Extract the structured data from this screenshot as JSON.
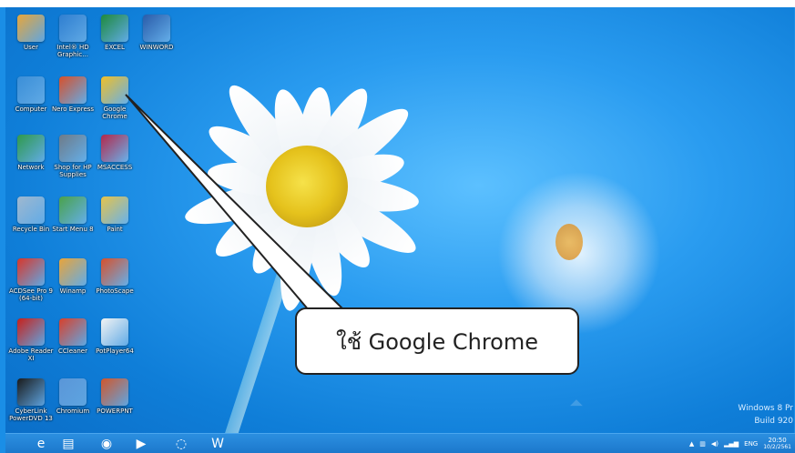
{
  "desktop": {
    "icons": [
      {
        "label": "User",
        "icon": "user-folder-icon",
        "color": "#e8a63a"
      },
      {
        "label": "Intel® HD Graphic...",
        "icon": "intel-graphics-icon",
        "color": "#2f7fd1"
      },
      {
        "label": "EXCEL",
        "icon": "excel-icon",
        "color": "#1f8a3c"
      },
      {
        "label": "WINWORD",
        "icon": "word-icon",
        "color": "#2a5caa"
      },
      {
        "label": "Computer",
        "icon": "computer-icon",
        "color": "#3b8fd8"
      },
      {
        "label": "Nero Express",
        "icon": "nero-icon",
        "color": "#d8502a"
      },
      {
        "label": "Google Chrome",
        "icon": "chrome-icon",
        "color": "#f2c027"
      },
      {
        "label": "Network",
        "icon": "network-icon",
        "color": "#2f9a4b"
      },
      {
        "label": "Shop for HP Supplies",
        "icon": "hp-shop-icon",
        "color": "#6f7b88"
      },
      {
        "label": "MSACCESS",
        "icon": "access-icon",
        "color": "#b4284a"
      },
      {
        "label": "Recycle Bin",
        "icon": "recycle-bin-icon",
        "color": "#9fb8cf"
      },
      {
        "label": "Start Menu 8",
        "icon": "start-menu-icon",
        "color": "#4aa24a"
      },
      {
        "label": "Paint",
        "icon": "paint-icon",
        "color": "#e7c44a"
      },
      {
        "label": "ACDSee Pro 9 (64-bit)",
        "icon": "acdsee-icon",
        "color": "#d8362a"
      },
      {
        "label": "Winamp",
        "icon": "winamp-icon",
        "color": "#e9a43a"
      },
      {
        "label": "PhotoScape",
        "icon": "photoscape-icon",
        "color": "#d8502a"
      },
      {
        "label": "Adobe Reader XI",
        "icon": "adobe-reader-icon",
        "color": "#c8201a"
      },
      {
        "label": "CCleaner",
        "icon": "ccleaner-icon",
        "color": "#d8402a"
      },
      {
        "label": "PotPlayer64",
        "icon": "potplayer-icon",
        "color": "#f3f3f3"
      },
      {
        "label": "CyberLink PowerDVD 13",
        "icon": "powerdvd-icon",
        "color": "#1a1a1a"
      },
      {
        "label": "Chromium",
        "icon": "chromium-icon",
        "color": "#5a96d8"
      },
      {
        "label": "POWERPNT",
        "icon": "powerpoint-icon",
        "color": "#d2562a"
      }
    ]
  },
  "callout": {
    "text": "ใช้ Google Chrome"
  },
  "watermark": {
    "line1": "Windows 8 Pr",
    "line2": "Build 920"
  },
  "taskbar": {
    "items": [
      {
        "icon": "internet-explorer-icon",
        "glyph": "e"
      },
      {
        "icon": "file-explorer-icon",
        "glyph": "▤"
      },
      {
        "icon": "chrome-icon",
        "glyph": "◉"
      },
      {
        "icon": "media-player-icon",
        "glyph": "▶"
      },
      {
        "icon": "chromium-icon",
        "glyph": "◌"
      },
      {
        "icon": "word-icon",
        "glyph": "W"
      }
    ],
    "tray": {
      "lang": "ENG",
      "time": "20:50",
      "date": "10/2/2561"
    }
  }
}
